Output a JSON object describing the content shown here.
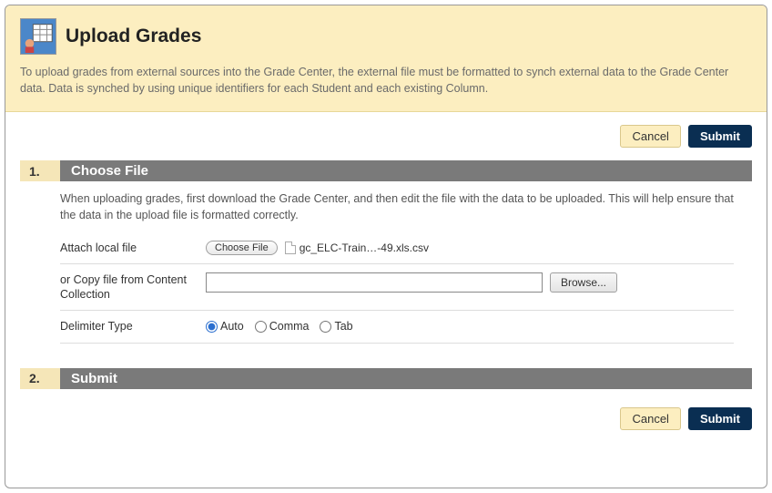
{
  "header": {
    "title": "Upload Grades",
    "intro": "To upload grades from external sources into the Grade Center, the external file must be formatted to synch external data to the Grade Center data. Data is synched by using unique identifiers for each Student and each existing Column."
  },
  "buttons": {
    "cancel": "Cancel",
    "submit": "Submit"
  },
  "section1": {
    "num": "1.",
    "title": "Choose File",
    "desc": "When uploading grades, first download the Grade Center, and then edit the file with the data to be uploaded. This will help ensure that the data in the upload file is formatted correctly.",
    "attach_label": "Attach local file",
    "choose_label": "Choose File",
    "filename": "gc_ELC-Train…-49.xls.csv",
    "copy_label": "or Copy file from Content Collection",
    "browse_label": "Browse...",
    "delimiter_label": "Delimiter Type",
    "delimiters": {
      "auto": "Auto",
      "comma": "Comma",
      "tab": "Tab"
    }
  },
  "section2": {
    "num": "2.",
    "title": "Submit"
  }
}
